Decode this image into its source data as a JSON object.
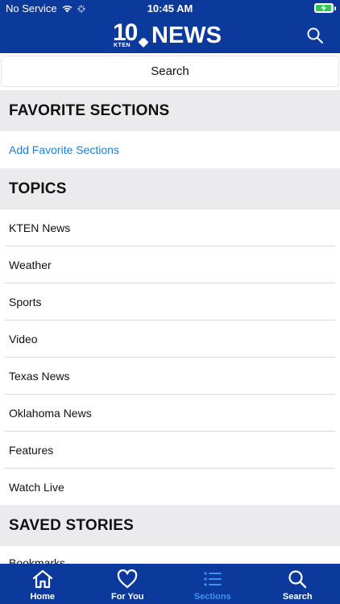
{
  "status_bar": {
    "carrier": "No Service",
    "time": "10:45 AM",
    "wifi_icon": "wifi-icon",
    "battery_icon": "battery-charging-icon"
  },
  "header": {
    "logo_number": "10",
    "logo_sub": "KTEN",
    "logo_word": "NEWS",
    "search_icon": "search-icon"
  },
  "search": {
    "label": "Search"
  },
  "favorite_sections": {
    "title": "FAVORITE SECTIONS",
    "add_label": "Add Favorite Sections"
  },
  "topics": {
    "title": "TOPICS",
    "items": [
      "KTEN News",
      "Weather",
      "Sports",
      "Video",
      "Texas News",
      "Oklahoma News",
      "Features",
      "Watch Live"
    ]
  },
  "saved_stories": {
    "title": "SAVED STORIES",
    "items": [
      "Bookmarks"
    ]
  },
  "tab_bar": {
    "tabs": [
      {
        "label": "Home",
        "icon": "home-icon",
        "active": false
      },
      {
        "label": "For You",
        "icon": "heart-icon",
        "active": false
      },
      {
        "label": "Sections",
        "icon": "list-icon",
        "active": true
      },
      {
        "label": "Search",
        "icon": "search-icon",
        "active": false
      }
    ]
  },
  "colors": {
    "brand_blue": "#0b3a9c",
    "link_blue": "#1a7fd6",
    "active_tab": "#3d8ff5",
    "section_bg": "#ebeaec"
  }
}
